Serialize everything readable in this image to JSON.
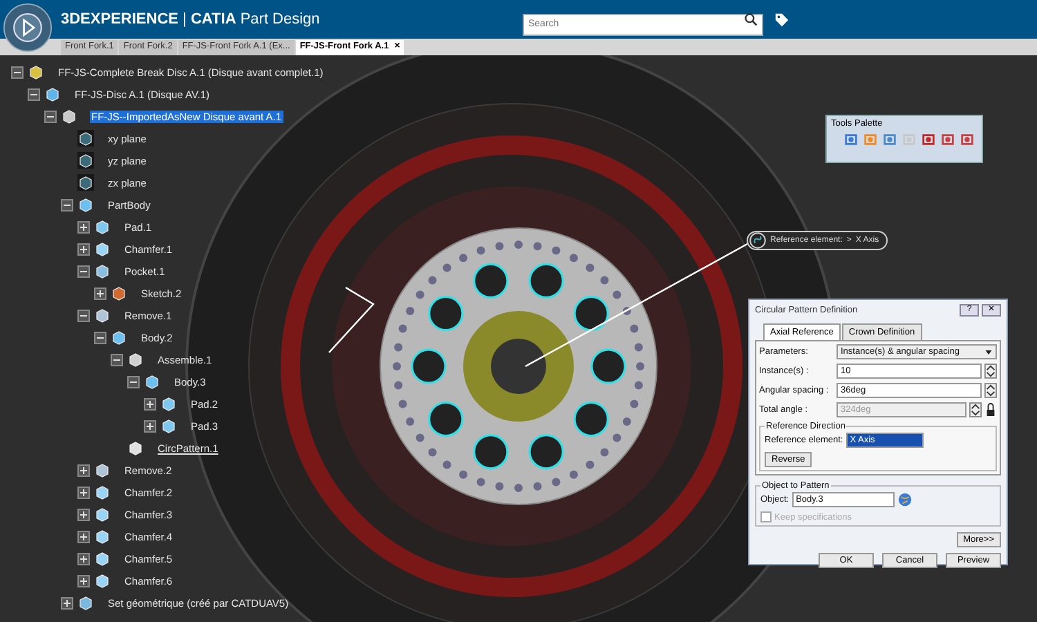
{
  "app": {
    "brand": "3DEXPERIENCE",
    "separator": "|",
    "product": "CATIA",
    "module": "Part Design"
  },
  "search": {
    "placeholder": "Search"
  },
  "tabs": [
    {
      "label": "Front Fork.1",
      "selected": false
    },
    {
      "label": "Front Fork.2",
      "selected": false
    },
    {
      "label": "FF-JS-Front Fork A.1 (Ex...",
      "selected": false
    },
    {
      "label": "FF-JS-Front Fork A.1",
      "selected": true,
      "close": "×"
    }
  ],
  "tree": [
    {
      "label": "FF-JS-Complete Break Disc A.1 (Disque avant complet.1)",
      "kind": "product",
      "expanded": true,
      "selected": false,
      "current": false,
      "children": [
        {
          "label": "FF-JS-Disc A.1 (Disque AV.1)",
          "kind": "part",
          "expanded": true,
          "selected": false,
          "current": false,
          "children": [
            {
              "label": "FF-JS--ImportedAsNew Disque avant A.1",
              "kind": "partnode",
              "expanded": true,
              "selected": true,
              "current": false,
              "children": [
                {
                  "label": "xy plane",
                  "kind": "plane",
                  "selected": false,
                  "current": false
                },
                {
                  "label": "yz plane",
                  "kind": "plane",
                  "selected": false,
                  "current": false
                },
                {
                  "label": "zx plane",
                  "kind": "plane",
                  "selected": false,
                  "current": false
                },
                {
                  "label": "PartBody",
                  "kind": "body",
                  "expanded": true,
                  "selected": false,
                  "current": false,
                  "children": [
                    {
                      "label": "Pad.1",
                      "kind": "pad",
                      "expanded": false,
                      "selected": false,
                      "current": false
                    },
                    {
                      "label": "Chamfer.1",
                      "kind": "chamfer",
                      "expanded": false,
                      "selected": false,
                      "current": false
                    },
                    {
                      "label": "Pocket.1",
                      "kind": "pocket",
                      "expanded": true,
                      "selected": false,
                      "current": false,
                      "children": [
                        {
                          "label": "Sketch.2",
                          "kind": "sketch",
                          "expanded": false,
                          "selected": false,
                          "current": false
                        }
                      ]
                    },
                    {
                      "label": "Remove.1",
                      "kind": "remove",
                      "expanded": true,
                      "selected": false,
                      "current": false,
                      "children": [
                        {
                          "label": "Body.2",
                          "kind": "body",
                          "expanded": true,
                          "selected": false,
                          "current": false,
                          "children": [
                            {
                              "label": "Assemble.1",
                              "kind": "assemble",
                              "expanded": true,
                              "selected": false,
                              "current": false,
                              "children": [
                                {
                                  "label": "Body.3",
                                  "kind": "body",
                                  "expanded": true,
                                  "selected": false,
                                  "current": false,
                                  "children": [
                                    {
                                      "label": "Pad.2",
                                      "kind": "pad",
                                      "expanded": false,
                                      "selected": false,
                                      "current": false
                                    },
                                    {
                                      "label": "Pad.3",
                                      "kind": "pad",
                                      "expanded": false,
                                      "selected": false,
                                      "current": false
                                    }
                                  ]
                                }
                              ]
                            },
                            {
                              "label": "CircPattern.1",
                              "kind": "pattern",
                              "selected": false,
                              "current": true
                            }
                          ]
                        }
                      ]
                    },
                    {
                      "label": "Remove.2",
                      "kind": "remove",
                      "expanded": false,
                      "selected": false,
                      "current": false
                    },
                    {
                      "label": "Chamfer.2",
                      "kind": "chamfer",
                      "expanded": false,
                      "selected": false,
                      "current": false
                    },
                    {
                      "label": "Chamfer.3",
                      "kind": "chamfer",
                      "expanded": false,
                      "selected": false,
                      "current": false
                    },
                    {
                      "label": "Chamfer.4",
                      "kind": "chamfer",
                      "expanded": false,
                      "selected": false,
                      "current": false
                    },
                    {
                      "label": "Chamfer.5",
                      "kind": "chamfer",
                      "expanded": false,
                      "selected": false,
                      "current": false
                    },
                    {
                      "label": "Chamfer.6",
                      "kind": "chamfer",
                      "expanded": false,
                      "selected": false,
                      "current": false
                    }
                  ]
                },
                {
                  "label": "Set géométrique (créé par CATDUAV5)",
                  "kind": "geoset",
                  "expanded": false,
                  "selected": false,
                  "current": false
                }
              ]
            }
          ]
        }
      ]
    }
  ],
  "tools_palette": {
    "title": "Tools Palette",
    "tools": [
      {
        "kind": "axis"
      },
      {
        "kind": "orange"
      },
      {
        "kind": "select"
      },
      {
        "kind": "sketch"
      },
      {
        "kind": "cut"
      },
      {
        "kind": "red"
      },
      {
        "kind": "red"
      }
    ]
  },
  "reference_tag": {
    "label": "Reference element:",
    "arrow": ">",
    "value": "X Axis"
  },
  "dialog": {
    "title": "Circular Pattern Definition",
    "help": "?",
    "close": "✕",
    "tabs": [
      {
        "label": "Axial Reference",
        "selected": true
      },
      {
        "label": "Crown Definition",
        "selected": false
      }
    ],
    "parameters": {
      "label": "Parameters:",
      "value": "Instance(s) & angular spacing"
    },
    "fields": [
      {
        "label": "Instance(s) :",
        "value": "10",
        "disabled": false
      },
      {
        "label": "Angular spacing :",
        "value": "36deg",
        "disabled": false
      },
      {
        "label": "Total angle :",
        "value": "324deg",
        "disabled": true
      }
    ],
    "reference_direction": {
      "title": "Reference Direction",
      "label": "Reference element:",
      "value": "X Axis",
      "button": "Reverse"
    },
    "object_to_pattern": {
      "title": "Object to Pattern",
      "label": "Object:",
      "value": "Body.3",
      "keep": {
        "label": "Keep specifications",
        "checked": false,
        "disabled": true
      }
    },
    "more": "More>>",
    "buttons": [
      "OK",
      "Cancel",
      "Preview"
    ]
  }
}
